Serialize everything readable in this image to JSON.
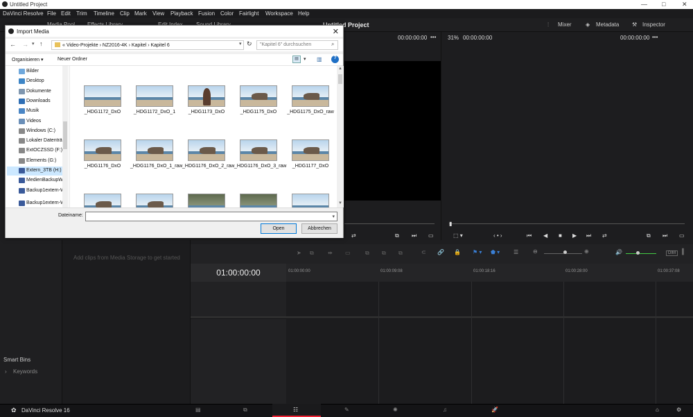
{
  "window": {
    "title": "Untitled Project",
    "minimize": "—",
    "maximize": "□",
    "close": "✕"
  },
  "menu": [
    "DaVinci Resolve",
    "File",
    "Edit",
    "Trim",
    "Timeline",
    "Clip",
    "Mark",
    "View",
    "Playback",
    "Fusion",
    "Color",
    "Fairlight",
    "Workspace",
    "Help"
  ],
  "toolbar": {
    "media_pool": "Media Pool",
    "effects_library": "Effects Library",
    "edit_index": "Edit Index",
    "sound_library": "Sound Library",
    "project_title": "Untitled Project",
    "mixer": "Mixer",
    "metadata": "Metadata",
    "inspector": "Inspector"
  },
  "viewer": {
    "src_timecode": "00:00:00:00",
    "zoom": "31%",
    "timeline_timecode": "00:00:00:00",
    "rec_timecode": "00:00:00:00"
  },
  "media_storage_hint": "Add clips from Media Storage to get started",
  "smart_bins": {
    "title": "Smart Bins",
    "keywords": "Keywords"
  },
  "timeline": {
    "timecode": "01:00:00:00",
    "ruler": [
      "01:00:00:00",
      "01:00:09:08",
      "01:00:18:16",
      "01:00:28:00",
      "01:00:37:08"
    ],
    "dim_label": "DIM"
  },
  "app_footer": {
    "brand": "DaVinci Resolve 16"
  },
  "dialog": {
    "title": "Import Media",
    "breadcrumb": "«  Video-Projekte  ›  NZ2016-4K  ›  Kapitel  ›  Kapitel 6",
    "search_placeholder": "\"Kapitel 6\" durchsuchen",
    "organize": "Organisieren ▾",
    "new_folder": "Neuer Ordner",
    "nav": [
      {
        "label": "Bilder",
        "color": "#6fa8dc"
      },
      {
        "label": "Desktop",
        "color": "#3d85c6"
      },
      {
        "label": "Dokumente",
        "color": "#7f97b0"
      },
      {
        "label": "Downloads",
        "color": "#2f6fb5"
      },
      {
        "label": "Musik",
        "color": "#4a86c5"
      },
      {
        "label": "Videos",
        "color": "#6a8fb8"
      },
      {
        "label": "Windows (C:)",
        "color": "#888888"
      },
      {
        "label": "Lokaler Datenträ",
        "color": "#888888"
      },
      {
        "label": "ExtOCZSSD (F:)",
        "color": "#888888"
      },
      {
        "label": "Elements (G:)",
        "color": "#888888"
      },
      {
        "label": "Extern_3TB (H:)",
        "color": "#3a5a9a"
      },
      {
        "label": "MedienBackupW",
        "color": "#3a5a9a"
      },
      {
        "label": "Backup1extern-W",
        "color": "#3a5a9a"
      },
      {
        "label": "Backup1extern-W",
        "color": "#3a5a9a"
      }
    ],
    "files": [
      {
        "name": "_HDG1172_DxO",
        "style": "beach"
      },
      {
        "name": "_HDG1172_DxO_1",
        "style": "beach"
      },
      {
        "name": "_HDG1173_DxO",
        "style": "person"
      },
      {
        "name": "_HDG1175_DxO",
        "style": "log"
      },
      {
        "name": "_HDG1175_DxO_raw",
        "style": "log"
      },
      {
        "name": "_HDG1176_DxO",
        "style": "log"
      },
      {
        "name": "_HDG1176_DxO_1_raw",
        "style": "log"
      },
      {
        "name": "_HDG1176_DxO_2_raw",
        "style": "log"
      },
      {
        "name": "_HDG1176_DxO_3_raw",
        "style": "log"
      },
      {
        "name": "_HDG1177_DxO",
        "style": "log"
      },
      {
        "name": "",
        "style": "log"
      },
      {
        "name": "",
        "style": "log"
      },
      {
        "name": "",
        "style": "dark"
      },
      {
        "name": "",
        "style": "dark"
      },
      {
        "name": "",
        "style": "beach"
      }
    ],
    "filename_label": "Dateiname:",
    "filename_value": "",
    "open": "Open",
    "cancel": "Abbrechen"
  }
}
